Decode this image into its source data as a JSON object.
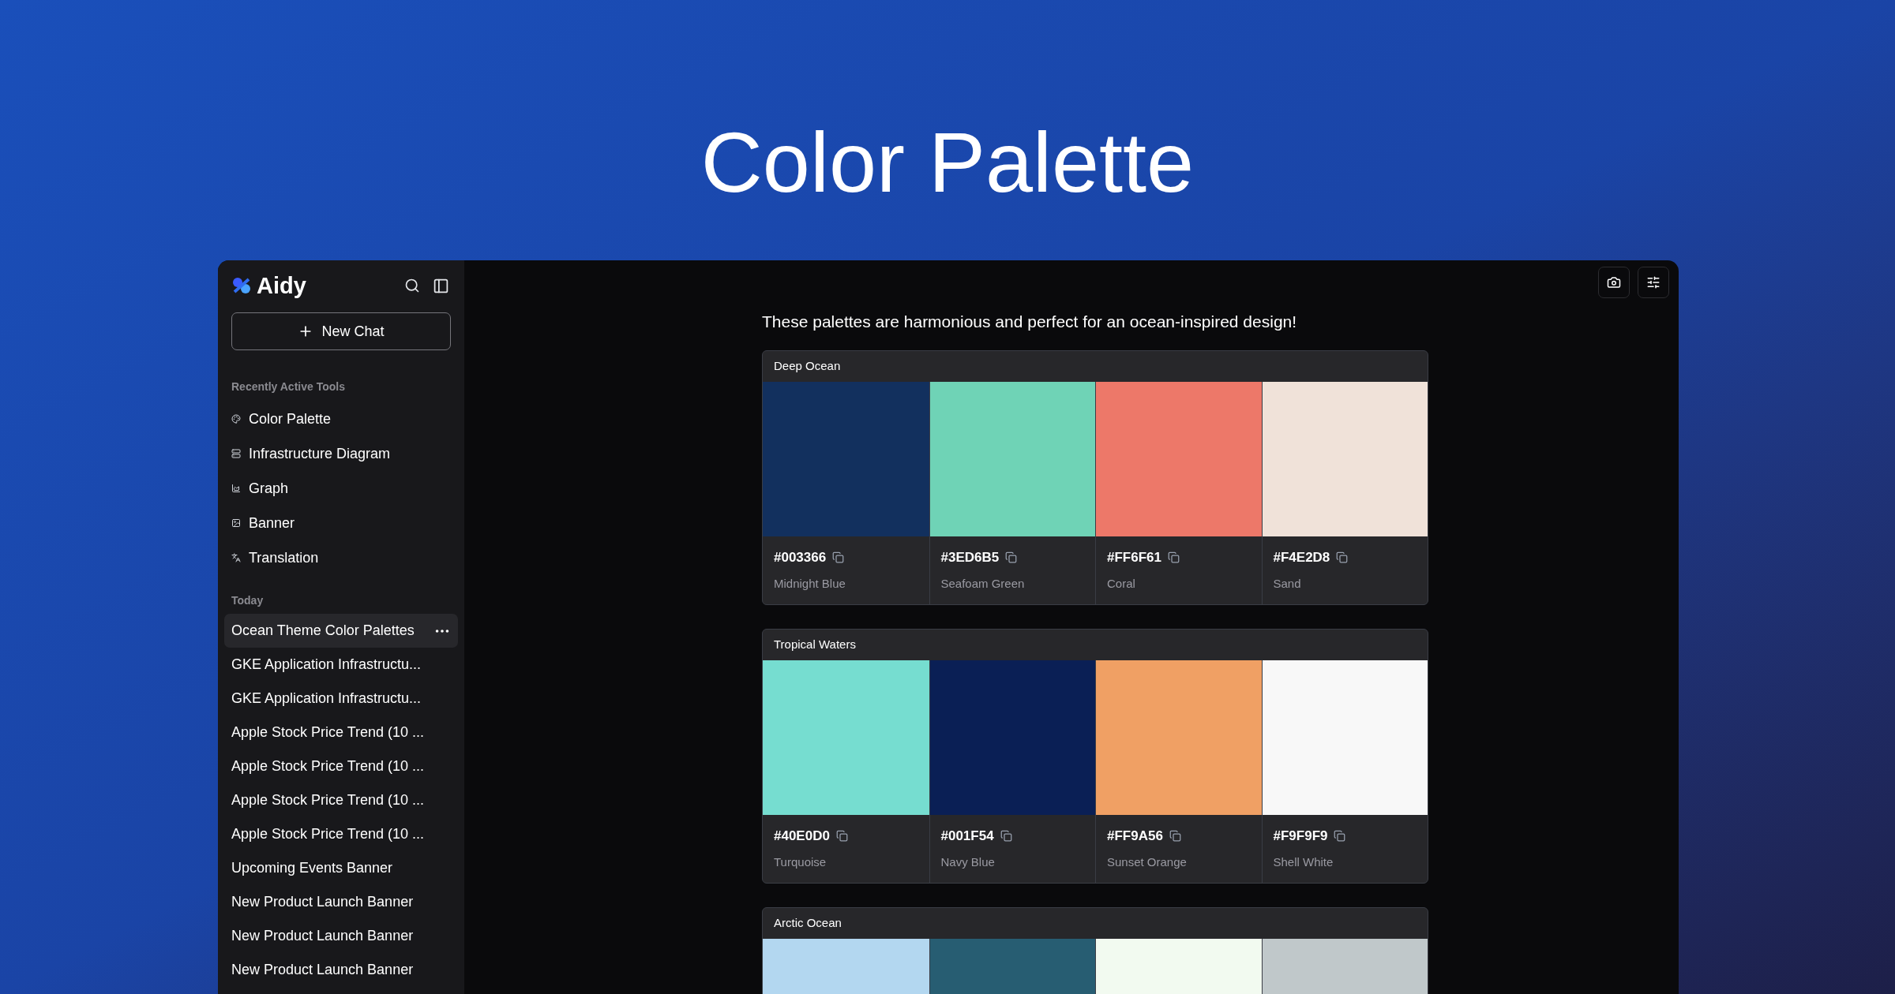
{
  "headline": "Color Palette",
  "sidebar": {
    "brand": "Aidy",
    "new_chat": "New Chat",
    "tools_heading": "Recently Active Tools",
    "tools": [
      {
        "label": "Color Palette",
        "kind": "palette"
      },
      {
        "label": "Infrastructure Diagram",
        "kind": "diagram"
      },
      {
        "label": "Graph",
        "kind": "graph"
      },
      {
        "label": "Banner",
        "kind": "banner"
      },
      {
        "label": "Translation",
        "kind": "translation"
      }
    ],
    "history_heading": "Today",
    "history": [
      {
        "title": "Ocean Theme Color Palettes",
        "selected": true
      },
      {
        "title": "GKE Application Infrastructu...",
        "selected": false
      },
      {
        "title": "GKE Application Infrastructu...",
        "selected": false
      },
      {
        "title": "Apple Stock Price Trend (10 ...",
        "selected": false
      },
      {
        "title": "Apple Stock Price Trend (10 ...",
        "selected": false
      },
      {
        "title": "Apple Stock Price Trend (10 ...",
        "selected": false
      },
      {
        "title": "Apple Stock Price Trend (10 ...",
        "selected": false
      },
      {
        "title": "Upcoming Events Banner",
        "selected": false
      },
      {
        "title": "New Product Launch Banner",
        "selected": false
      },
      {
        "title": "New Product Launch Banner",
        "selected": false
      },
      {
        "title": "New Product Launch Banner",
        "selected": false
      }
    ]
  },
  "chat": {
    "message": "These palettes are harmonious and perfect for an ocean-inspired design!",
    "palettes": [
      {
        "name": "Deep Ocean",
        "colors": [
          {
            "hex": "#003366",
            "name": "Midnight Blue",
            "color": "#12305e"
          },
          {
            "hex": "#3ED6B5",
            "name": "Seafoam Green",
            "color": "#6fd3b6"
          },
          {
            "hex": "#FF6F61",
            "name": "Coral",
            "color": "#ed7869"
          },
          {
            "hex": "#F4E2D8",
            "name": "Sand",
            "color": "#f0e2d9"
          }
        ]
      },
      {
        "name": "Tropical Waters",
        "colors": [
          {
            "hex": "#40E0D0",
            "name": "Turquoise",
            "color": "#76ddd0"
          },
          {
            "hex": "#001F54",
            "name": "Navy Blue",
            "color": "#0a1f55"
          },
          {
            "hex": "#FF9A56",
            "name": "Sunset Orange",
            "color": "#f0a064"
          },
          {
            "hex": "#F9F9F9",
            "name": "Shell White",
            "color": "#f8f8f8"
          }
        ]
      },
      {
        "name": "Arctic Ocean",
        "colors": [
          {
            "color": "#b3d7f0"
          },
          {
            "color": "#275d72"
          },
          {
            "color": "#f2faf0"
          },
          {
            "color": "#c0c8ca"
          }
        ]
      }
    ]
  }
}
